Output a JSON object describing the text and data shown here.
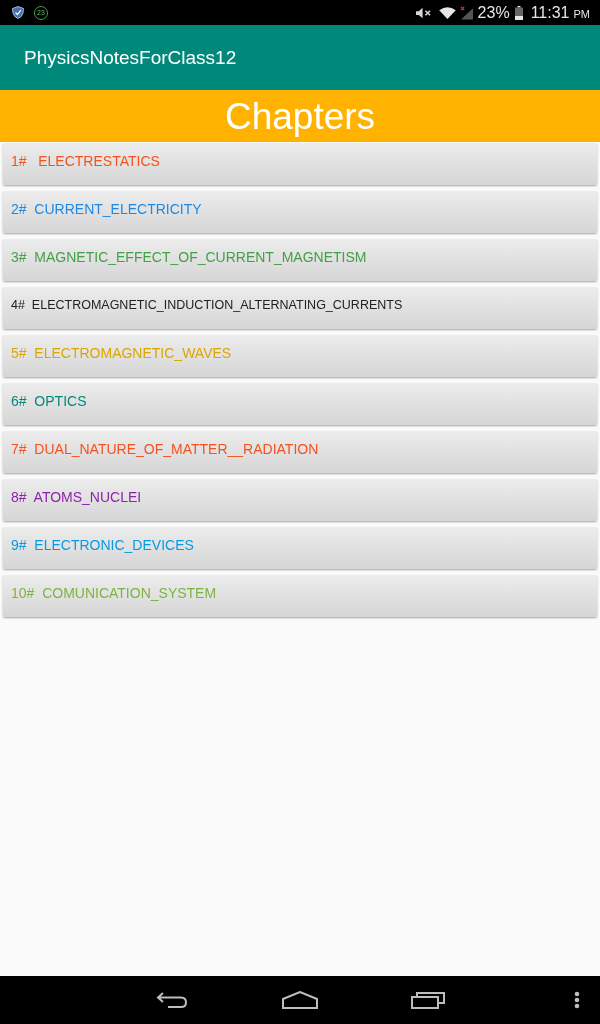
{
  "status_bar": {
    "notification_count": "23",
    "battery": "23%",
    "time": "11:31",
    "meridiem": "PM"
  },
  "app_bar": {
    "title": "PhysicsNotesForClass12"
  },
  "header": {
    "title": "Chapters"
  },
  "chapters": [
    {
      "label": "1#   ELECTRESTATICS",
      "color": "#f4511e"
    },
    {
      "label": "2#  CURRENT_ELECTRICITY",
      "color": "#1e88e5"
    },
    {
      "label": "3#  MAGNETIC_EFFECT_OF_CURRENT_MAGNETISM",
      "color": "#43a047"
    },
    {
      "label": "4#  ELECTROMAGNETIC_INDUCTION_ALTERNATING_CURRENTS",
      "color": "#212121"
    },
    {
      "label": "5#  ELECTROMAGNETIC_WAVES",
      "color": "#dca600"
    },
    {
      "label": "6#  OPTICS",
      "color": "#00897b"
    },
    {
      "label": "7#  DUAL_NATURE_OF_MATTER__RADIATION",
      "color": "#f4511e"
    },
    {
      "label": "8#  ATOMS_NUCLEI",
      "color": "#8e24aa"
    },
    {
      "label": "9#  ELECTRONIC_DEVICES",
      "color": "#039be5"
    },
    {
      "label": "10#  COMUNICATION_SYSTEM",
      "color": "#7cb342"
    }
  ]
}
